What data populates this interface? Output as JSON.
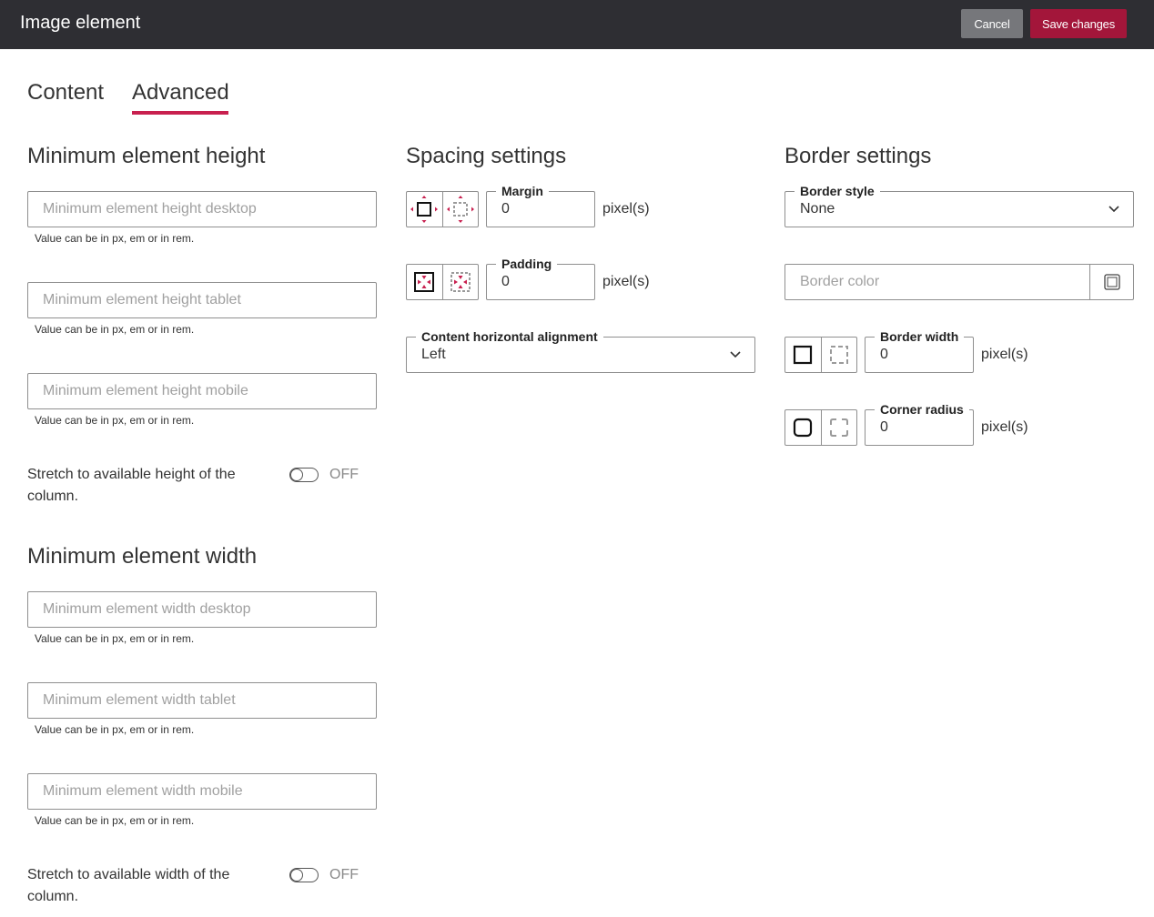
{
  "header": {
    "title": "Image element",
    "cancel_label": "Cancel",
    "save_label": "Save changes"
  },
  "tabs": [
    {
      "label": "Content",
      "active": false
    },
    {
      "label": "Advanced",
      "active": true
    }
  ],
  "min_height": {
    "title": "Minimum element height",
    "desktop_placeholder": "Minimum element height desktop",
    "tablet_placeholder": "Minimum element height tablet",
    "mobile_placeholder": "Minimum element height mobile",
    "hint": "Value can be in px, em or in rem.",
    "stretch_label": "Stretch to available height of the column.",
    "stretch_state": "OFF"
  },
  "min_width": {
    "title": "Minimum element width",
    "desktop_placeholder": "Minimum element width desktop",
    "tablet_placeholder": "Minimum element width tablet",
    "mobile_placeholder": "Minimum element width mobile",
    "hint": "Value can be in px, em or in rem.",
    "stretch_label": "Stretch to available width of the column.",
    "stretch_state": "OFF"
  },
  "spacing": {
    "title": "Spacing settings",
    "margin_label": "Margin",
    "margin_value": "0",
    "padding_label": "Padding",
    "padding_value": "0",
    "unit": "pixel(s)",
    "alignment_label": "Content horizontal alignment",
    "alignment_value": "Left"
  },
  "border": {
    "title": "Border settings",
    "style_label": "Border style",
    "style_value": "None",
    "color_placeholder": "Border color",
    "width_label": "Border width",
    "width_value": "0",
    "radius_label": "Corner radius",
    "radius_value": "0",
    "unit": "pixel(s)"
  },
  "colors": {
    "header_bg": "#2e2e33",
    "accent": "#c8204f",
    "save_bg": "#a3163a",
    "cancel_bg": "#76777b"
  }
}
